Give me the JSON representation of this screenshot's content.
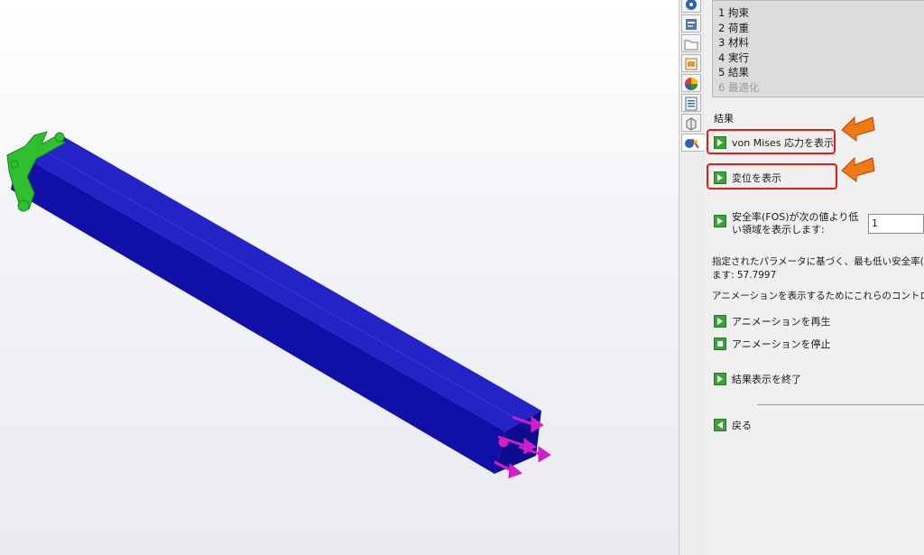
{
  "steps": [
    {
      "num": "1",
      "label": "拘束"
    },
    {
      "num": "2",
      "label": "荷重"
    },
    {
      "num": "3",
      "label": "材料"
    },
    {
      "num": "4",
      "label": "実行"
    },
    {
      "num": "5",
      "label": "結果"
    },
    {
      "num": "6",
      "label": "最適化"
    }
  ],
  "results": {
    "section_title": "結果",
    "von_mises_label": "von Mises 応力を表示",
    "displacement_label": "変位を表示",
    "fos_label_line1": "安全率(FOS)が次の値より低",
    "fos_label_line2": "い領域を表示します:",
    "fos_value": "1",
    "min_fos_line1": "指定されたパラメータに基づく、最も低い安全率(FO",
    "min_fos_line2": "ます: 57.7997",
    "animation_hint": "アニメーションを表示するためにこれらのコントロー",
    "play_label": "アニメーションを再生",
    "stop_label": "アニメーションを停止",
    "exit_label": "結果表示を終了",
    "back_label": "戻る"
  },
  "colors": {
    "beam": "#1a1ab3",
    "fixture": "#2fbf2f",
    "load": "#d11fc8",
    "highlight": "#e21b1b",
    "callout_arrow": "#f07a12"
  },
  "icons": [
    "simulation-tab-icon",
    "property-tab-icon",
    "folder-tab-icon",
    "config-tab-icon",
    "appearance-tab-icon",
    "list-tab-icon",
    "model-tab-icon",
    "simxpress-tab-icon"
  ]
}
